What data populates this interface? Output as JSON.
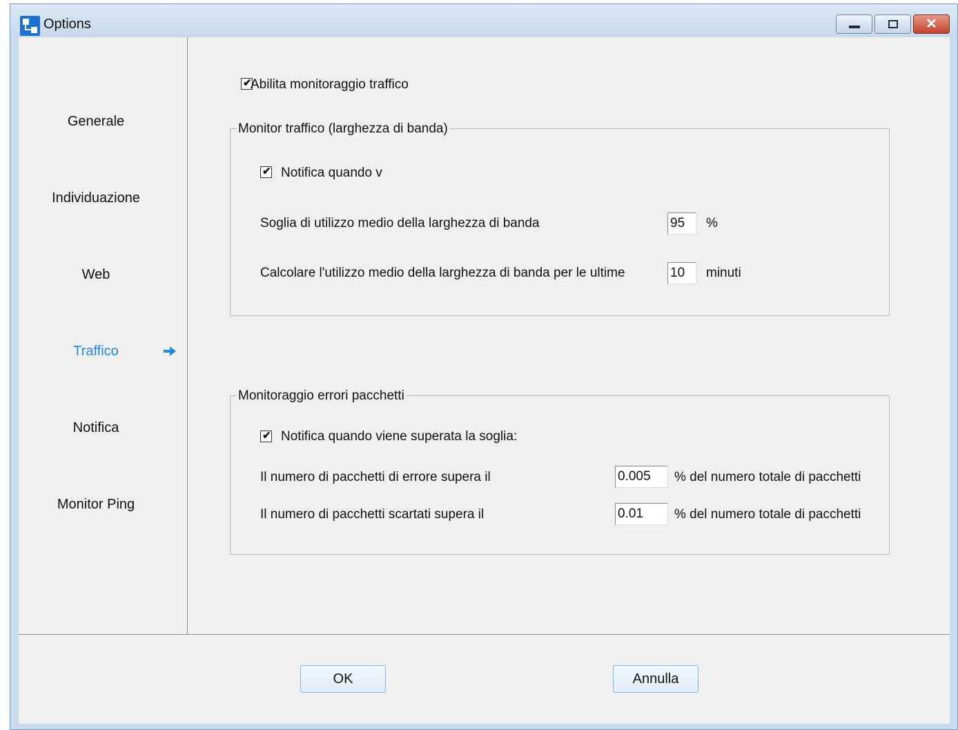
{
  "window": {
    "title": "Options",
    "close_glyph": "✕"
  },
  "sidebar": {
    "items": [
      {
        "label": "Generale"
      },
      {
        "label": "Individuazione"
      },
      {
        "label": "Web"
      },
      {
        "label": "Traffico",
        "active": true
      },
      {
        "label": "Notifica"
      },
      {
        "label": "Monitor Ping"
      }
    ],
    "active_color": "#1e88e5"
  },
  "main": {
    "enable_traffic": {
      "label": "Abilita monitoraggio traffico",
      "checked": true
    },
    "bandwidth_group": {
      "title": "Monitor traffico (larghezza di banda)",
      "notify": {
        "label": "Notifica quando v",
        "checked": true
      },
      "threshold": {
        "label": "Soglia di utilizzo medio della larghezza di banda",
        "value": "95",
        "unit": "%"
      },
      "average": {
        "label": "Calcolare l'utilizzo medio della larghezza di banda per le ultime",
        "value": "10",
        "unit": "minuti"
      }
    },
    "packet_group": {
      "title": "Monitoraggio errori pacchetti",
      "notify": {
        "label": "Notifica quando viene superata la soglia:",
        "checked": true
      },
      "errors": {
        "label": "Il numero di pacchetti di errore supera il",
        "value": "0.005",
        "unit": "% del numero totale di pacchetti"
      },
      "dropped": {
        "label": "Il numero di pacchetti scartati supera il",
        "value": "0.01",
        "unit": "% del numero totale di pacchetti"
      }
    }
  },
  "footer": {
    "ok_label": "OK",
    "cancel_label": "Annulla"
  }
}
